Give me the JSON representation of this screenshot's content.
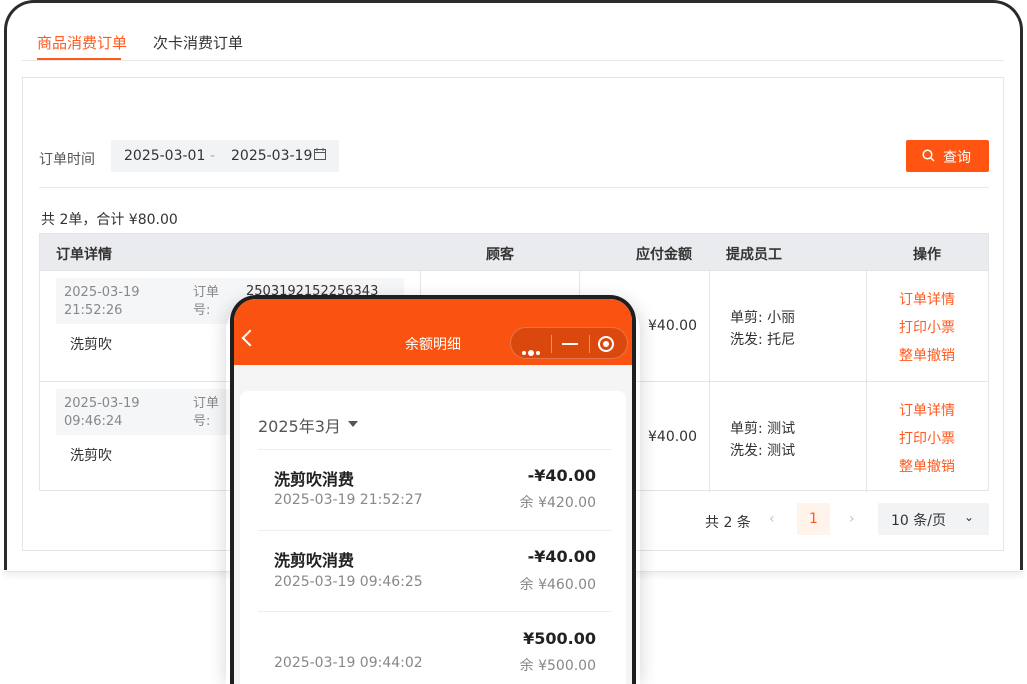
{
  "tabs": [
    {
      "label": "商品消费订单",
      "active": true
    },
    {
      "label": "次卡消费订单",
      "active": false
    }
  ],
  "filter": {
    "label": "订单时间",
    "start_date": "2025-03-01",
    "separator": "-",
    "end_date": "2025-03-19",
    "calendar_icon": "calendar-icon",
    "query_label": "查询",
    "query_icon": "search-icon"
  },
  "summary": "共 2单，合计 ¥80.00",
  "table": {
    "headers": [
      "订单详情",
      "顾客",
      "应付金额",
      "提成员工",
      "操作"
    ],
    "order_label": "订单号:",
    "rows": [
      {
        "time": "2025-03-19 21:52:26",
        "order_no": "2503192152256343",
        "service": "洗剪吹",
        "amount": "¥40.00",
        "staff": [
          "单剪: 小丽",
          "洗发: 托尼"
        ],
        "ops": [
          "订单详情",
          "打印小票",
          "整单撤销"
        ]
      },
      {
        "time": "2025-03-19 09:46:24",
        "order_no": "",
        "service": "洗剪吹",
        "amount": "¥40.00",
        "staff": [
          "单剪: 测试",
          "洗发: 测试"
        ],
        "ops": [
          "订单详情",
          "打印小票",
          "整单撤销"
        ]
      }
    ]
  },
  "pagination": {
    "total": "共 2 条",
    "prev": "‹",
    "page": "1",
    "next": "›",
    "page_size": "10 条/页",
    "page_size_caret": "⌄"
  },
  "phone": {
    "title": "余额明细",
    "back_icon": "back-icon",
    "month": "2025年3月",
    "transactions": [
      {
        "name": "洗剪吹消费",
        "amount": "-¥40.00",
        "time": "2025-03-19 21:52:27",
        "balance": "余 ¥420.00"
      },
      {
        "name": "洗剪吹消费",
        "amount": "-¥40.00",
        "time": "2025-03-19 09:46:25",
        "balance": "余 ¥460.00"
      },
      {
        "name": "",
        "amount": "¥500.00",
        "time": "2025-03-19 09:44:02",
        "balance": "余 ¥500.00"
      }
    ]
  },
  "colors": {
    "accent": "#ff5a1f",
    "nav_bg": "#fa5311"
  }
}
